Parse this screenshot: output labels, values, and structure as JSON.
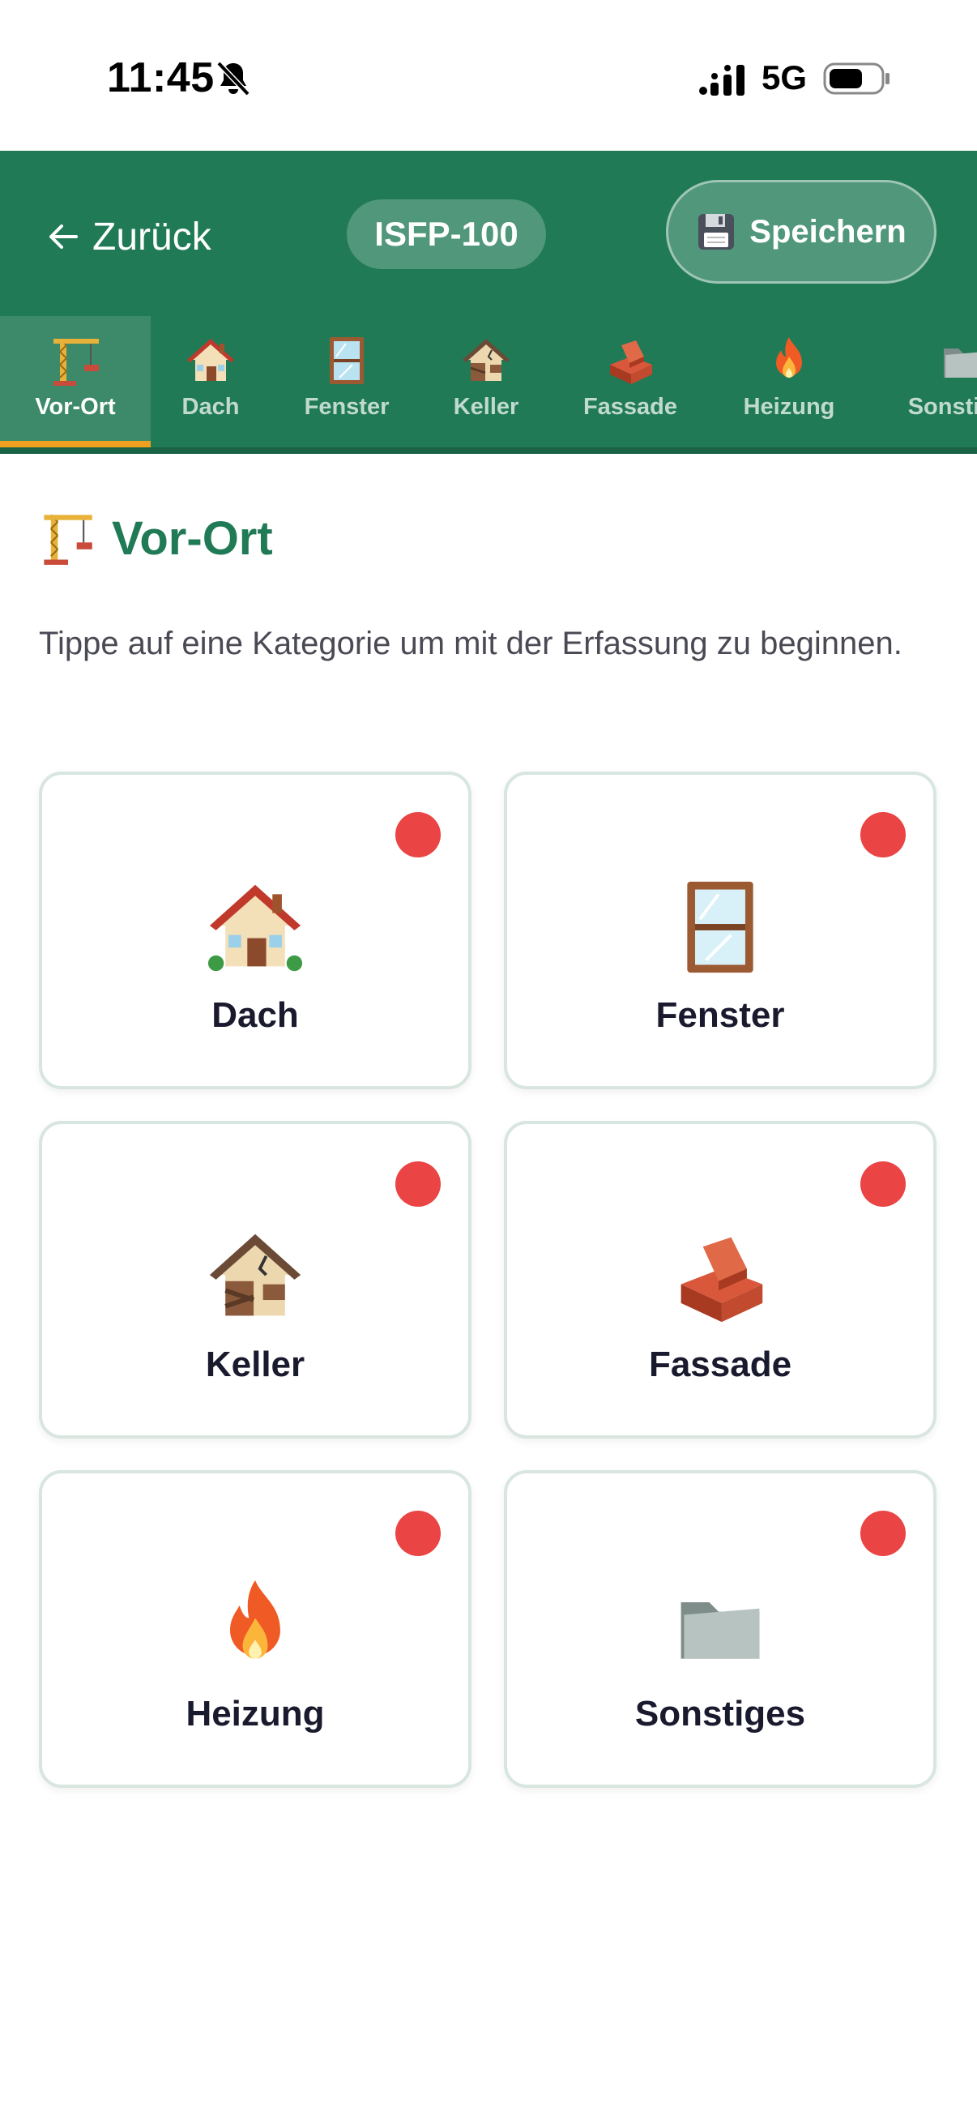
{
  "status_bar": {
    "time": "11:45",
    "network": "5G"
  },
  "header": {
    "back_label": "Zurück",
    "project_id": "ISFP-100",
    "save_label": "Speichern"
  },
  "tabs": [
    {
      "label": "Vor-Ort",
      "icon": "crane-icon",
      "active": true
    },
    {
      "label": "Dach",
      "icon": "house-icon",
      "active": false
    },
    {
      "label": "Fenster",
      "icon": "window-icon",
      "active": false
    },
    {
      "label": "Keller",
      "icon": "derelict-house-icon",
      "active": false
    },
    {
      "label": "Fassade",
      "icon": "bricks-icon",
      "active": false
    },
    {
      "label": "Heizung",
      "icon": "fire-icon",
      "active": false
    },
    {
      "label": "Sonstiges",
      "icon": "folder-icon",
      "active": false
    }
  ],
  "section": {
    "title": "Vor-Ort",
    "intro": "Tippe auf eine Kategorie um mit der Erfassung zu beginnen."
  },
  "cards": [
    {
      "label": "Dach",
      "icon": "house-icon",
      "status_color": "#ea4444"
    },
    {
      "label": "Fenster",
      "icon": "window-icon",
      "status_color": "#ea4444"
    },
    {
      "label": "Keller",
      "icon": "derelict-house-icon",
      "status_color": "#ea4444"
    },
    {
      "label": "Fassade",
      "icon": "bricks-icon",
      "status_color": "#ea4444"
    },
    {
      "label": "Heizung",
      "icon": "fire-icon",
      "status_color": "#ea4444"
    },
    {
      "label": "Sonstiges",
      "icon": "folder-icon",
      "status_color": "#ea4444"
    }
  ],
  "colors": {
    "primary": "#217a56",
    "accent": "#f0a020",
    "status_dot": "#ea4444"
  }
}
